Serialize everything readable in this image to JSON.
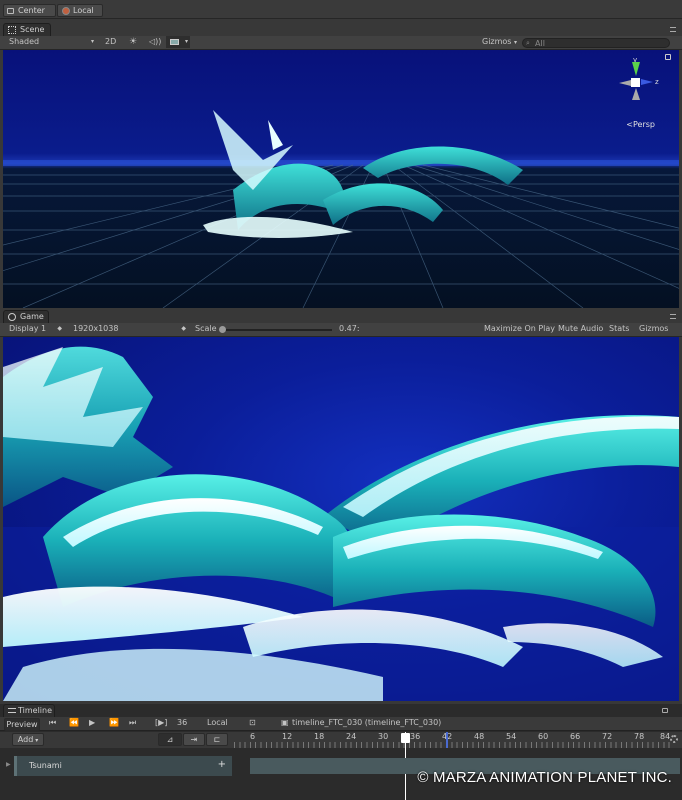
{
  "toolbar": {
    "center_label": "Center",
    "local_label": "Local"
  },
  "scene": {
    "tab_label": "Scene",
    "shading_mode": "Shaded",
    "mode_2d": "2D",
    "gizmos_label": "Gizmos",
    "search_placeholder": "All",
    "persp_label": "Persp",
    "axis_y": "y",
    "axis_z": "z"
  },
  "game": {
    "tab_label": "Game",
    "display": "Display 1",
    "resolution": "1920x1038",
    "scale_label": "Scale",
    "scale_value": "0.47:",
    "maximize_label": "Maximize On Play",
    "mute_label": "Mute Audio",
    "stats_label": "Stats",
    "gizmos_label": "Gizmos"
  },
  "timeline": {
    "tab_label": "Timeline",
    "preview_label": "Preview",
    "frame_value": "36",
    "local_label": "Local",
    "asset_label": "timeline_FTC_030 (timeline_FTC_030)",
    "add_label": "Add",
    "ruler_ticks": [
      "6",
      "12",
      "18",
      "24",
      "30",
      "36",
      "42",
      "48",
      "54",
      "60",
      "66",
      "72",
      "78",
      "84"
    ],
    "playhead_frame": 36,
    "track_name": "Tsunami"
  },
  "copyright": "© MARZA ANIMATION PLANET INC.",
  "colors": {
    "editor_bg": "#383838",
    "scene_sky": "#0a1c8c",
    "water": "#2ec4c4",
    "playhead": "#ffffff",
    "axis_y": "#5ad24a",
    "axis_z": "#3a5ae0"
  }
}
